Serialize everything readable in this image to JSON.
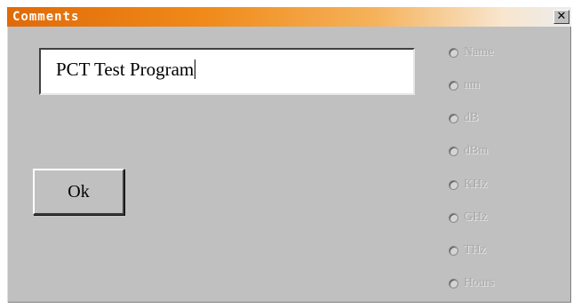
{
  "window": {
    "title": "Comments",
    "close_glyph": "✕"
  },
  "comment": {
    "value": "PCT Test Program"
  },
  "ok_button": {
    "label": "Ok"
  },
  "units": {
    "enabled": false,
    "options": [
      "Name",
      "nm",
      "dB",
      "dBm",
      "KHz",
      "GHz",
      "THz",
      "Hours"
    ]
  },
  "colors": {
    "titlebar_start": "#e06a08",
    "titlebar_end": "#ececec",
    "dialog_face": "#c0c0c0",
    "disabled_text": "#a8a8a8"
  }
}
